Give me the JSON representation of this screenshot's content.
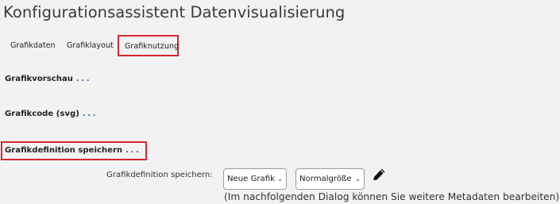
{
  "page": {
    "title": "Konfigurationsassistent Datenvisualisierung"
  },
  "tabs": [
    {
      "label": "Grafikdaten"
    },
    {
      "label": "Grafiklayout"
    },
    {
      "label": "Grafiknutzung"
    }
  ],
  "sections": [
    {
      "label": "Grafikvorschau",
      "dots": "..."
    },
    {
      "label": "Grafikcode (svg)",
      "dots": "..."
    },
    {
      "label": "Grafikdefinition speichern",
      "dots": "..."
    }
  ],
  "save_form": {
    "label": "Grafikdefinition speichern:",
    "graphic_select_value": "Neue Grafik",
    "size_select_value": "Normalgröße",
    "edit_icon": "pencil-icon",
    "hint": "(Im nachfolgenden Dialog können Sie weitere Metadaten bearbeiten)"
  },
  "colors": {
    "highlight_border": "#d9262b",
    "dots": "#2a6bc4"
  }
}
